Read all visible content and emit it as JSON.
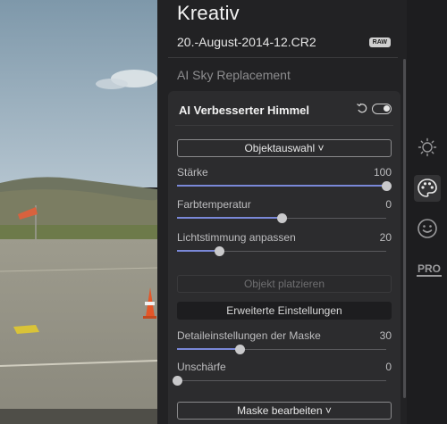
{
  "panel": {
    "title": "Kreativ",
    "filename": "20.-August-2014-12.CR2",
    "raw_badge": "RAW",
    "section_collapsed": "AI Sky Replacement"
  },
  "card": {
    "title": "AI Verbesserter Himmel",
    "object_select_button": "Objektauswahl ˅",
    "place_object_button": "Objekt platzieren",
    "advanced_button": "Erweiterte Einstellungen",
    "edit_mask_button": "Maske bearbeiten ˅",
    "sliders": [
      {
        "label": "Stärke",
        "value": "100",
        "level": 1.0
      },
      {
        "label": "Farbtemperatur",
        "value": "0",
        "level": 0.5
      },
      {
        "label": "Lichtstimmung anpassen",
        "value": "20",
        "level": 0.2
      },
      {
        "label": "Detaileinstellungen der Maske",
        "value": "30",
        "level": 0.3
      },
      {
        "label": "Unschärfe",
        "value": "0",
        "level": 0.0
      }
    ]
  },
  "rail": {
    "items": [
      "sun-icon",
      "palette-icon",
      "smiley-icon"
    ],
    "pro_label": "PRO",
    "active": "palette-icon"
  },
  "colors": {
    "accent": "#7a88d8",
    "panel_bg": "#222224",
    "card_bg": "#2c2c2e"
  }
}
